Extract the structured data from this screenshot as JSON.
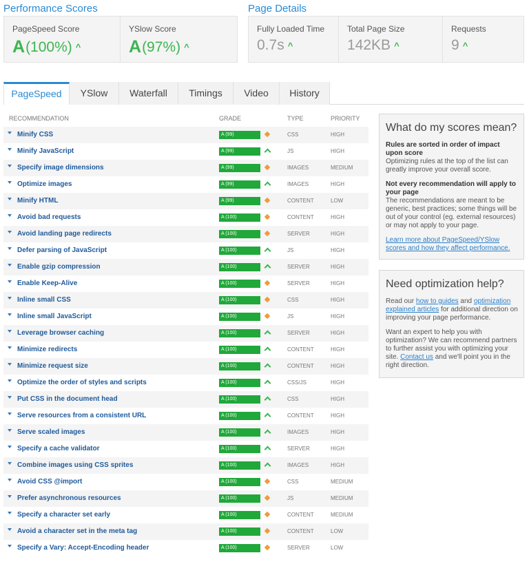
{
  "performance": {
    "title": "Performance Scores",
    "pagespeed": {
      "label": "PageSpeed Score",
      "grade": "A",
      "score": "(100%)",
      "trend": "^"
    },
    "yslow": {
      "label": "YSlow Score",
      "grade": "A",
      "score": "(97%)",
      "trend": "^"
    }
  },
  "details": {
    "title": "Page Details",
    "fully_loaded": {
      "label": "Fully Loaded Time",
      "value": "0.7s",
      "trend": "^"
    },
    "page_size": {
      "label": "Total Page Size",
      "value": "142KB",
      "trend": "^"
    },
    "requests": {
      "label": "Requests",
      "value": "9",
      "trend": "^"
    }
  },
  "tabs": [
    "PageSpeed",
    "YSlow",
    "Waterfall",
    "Timings",
    "Video",
    "History"
  ],
  "active_tab": "PageSpeed",
  "table": {
    "headers": {
      "recommendation": "RECOMMENDATION",
      "grade": "GRADE",
      "type": "TYPE",
      "priority": "PRIORITY"
    },
    "rows": [
      {
        "name": "Minify CSS",
        "grade": "A (99)",
        "indicator": "diamond",
        "type": "CSS",
        "priority": "HIGH"
      },
      {
        "name": "Minify JavaScript",
        "grade": "A (99)",
        "indicator": "up",
        "type": "JS",
        "priority": "HIGH"
      },
      {
        "name": "Specify image dimensions",
        "grade": "A (99)",
        "indicator": "diamond",
        "type": "IMAGES",
        "priority": "MEDIUM"
      },
      {
        "name": "Optimize images",
        "grade": "A (99)",
        "indicator": "up",
        "type": "IMAGES",
        "priority": "HIGH"
      },
      {
        "name": "Minify HTML",
        "grade": "A (99)",
        "indicator": "diamond",
        "type": "CONTENT",
        "priority": "LOW"
      },
      {
        "name": "Avoid bad requests",
        "grade": "A (100)",
        "indicator": "diamond",
        "type": "CONTENT",
        "priority": "HIGH"
      },
      {
        "name": "Avoid landing page redirects",
        "grade": "A (100)",
        "indicator": "diamond",
        "type": "SERVER",
        "priority": "HIGH"
      },
      {
        "name": "Defer parsing of JavaScript",
        "grade": "A (100)",
        "indicator": "up",
        "type": "JS",
        "priority": "HIGH"
      },
      {
        "name": "Enable gzip compression",
        "grade": "A (100)",
        "indicator": "up",
        "type": "SERVER",
        "priority": "HIGH"
      },
      {
        "name": "Enable Keep-Alive",
        "grade": "A (100)",
        "indicator": "diamond",
        "type": "SERVER",
        "priority": "HIGH"
      },
      {
        "name": "Inline small CSS",
        "grade": "A (100)",
        "indicator": "diamond",
        "type": "CSS",
        "priority": "HIGH"
      },
      {
        "name": "Inline small JavaScript",
        "grade": "A (100)",
        "indicator": "diamond",
        "type": "JS",
        "priority": "HIGH"
      },
      {
        "name": "Leverage browser caching",
        "grade": "A (100)",
        "indicator": "up",
        "type": "SERVER",
        "priority": "HIGH"
      },
      {
        "name": "Minimize redirects",
        "grade": "A (100)",
        "indicator": "up",
        "type": "CONTENT",
        "priority": "HIGH"
      },
      {
        "name": "Minimize request size",
        "grade": "A (100)",
        "indicator": "up",
        "type": "CONTENT",
        "priority": "HIGH"
      },
      {
        "name": "Optimize the order of styles and scripts",
        "grade": "A (100)",
        "indicator": "up",
        "type": "CSS/JS",
        "priority": "HIGH"
      },
      {
        "name": "Put CSS in the document head",
        "grade": "A (100)",
        "indicator": "up",
        "type": "CSS",
        "priority": "HIGH"
      },
      {
        "name": "Serve resources from a consistent URL",
        "grade": "A (100)",
        "indicator": "up",
        "type": "CONTENT",
        "priority": "HIGH"
      },
      {
        "name": "Serve scaled images",
        "grade": "A (100)",
        "indicator": "up",
        "type": "IMAGES",
        "priority": "HIGH"
      },
      {
        "name": "Specify a cache validator",
        "grade": "A (100)",
        "indicator": "up",
        "type": "SERVER",
        "priority": "HIGH"
      },
      {
        "name": "Combine images using CSS sprites",
        "grade": "A (100)",
        "indicator": "up",
        "type": "IMAGES",
        "priority": "HIGH"
      },
      {
        "name": "Avoid CSS @import",
        "grade": "A (100)",
        "indicator": "diamond",
        "type": "CSS",
        "priority": "MEDIUM"
      },
      {
        "name": "Prefer asynchronous resources",
        "grade": "A (100)",
        "indicator": "diamond",
        "type": "JS",
        "priority": "MEDIUM"
      },
      {
        "name": "Specify a character set early",
        "grade": "A (100)",
        "indicator": "diamond",
        "type": "CONTENT",
        "priority": "MEDIUM"
      },
      {
        "name": "Avoid a character set in the meta tag",
        "grade": "A (100)",
        "indicator": "diamond",
        "type": "CONTENT",
        "priority": "LOW"
      },
      {
        "name": "Specify a Vary: Accept-Encoding header",
        "grade": "A (100)",
        "indicator": "diamond",
        "type": "SERVER",
        "priority": "LOW"
      }
    ]
  },
  "scores_box": {
    "title": "What do my scores mean?",
    "h1": "Rules are sorted in order of impact upon score",
    "p1": "Optimizing rules at the top of the list can greatly improve your overall score.",
    "h2": "Not every recommendation will apply to your page",
    "p2": "The recommendations are meant to be generic, best practices; some things will be out of your control (eg. external resources) or may not apply to your page.",
    "link": "Learn more about PageSpeed/YSlow scores and how they affect performance."
  },
  "help_box": {
    "title": "Need optimization help?",
    "p1_a": "Read our ",
    "p1_link1": "how to guides",
    "p1_b": " and ",
    "p1_link2": "optimization explained articles",
    "p1_c": " for additional direction on improving your page performance.",
    "p2_a": "Want an expert to help you with optimization? We can recommend partners to further assist you with optimizing your site. ",
    "p2_link": "Contact us",
    "p2_b": " and we'll point you in the right direction."
  },
  "colors": {
    "accent": "#2a8ad4",
    "grade_green": "#20a83a",
    "diamond_orange": "#f29a3a",
    "up_green": "#3cb550"
  }
}
